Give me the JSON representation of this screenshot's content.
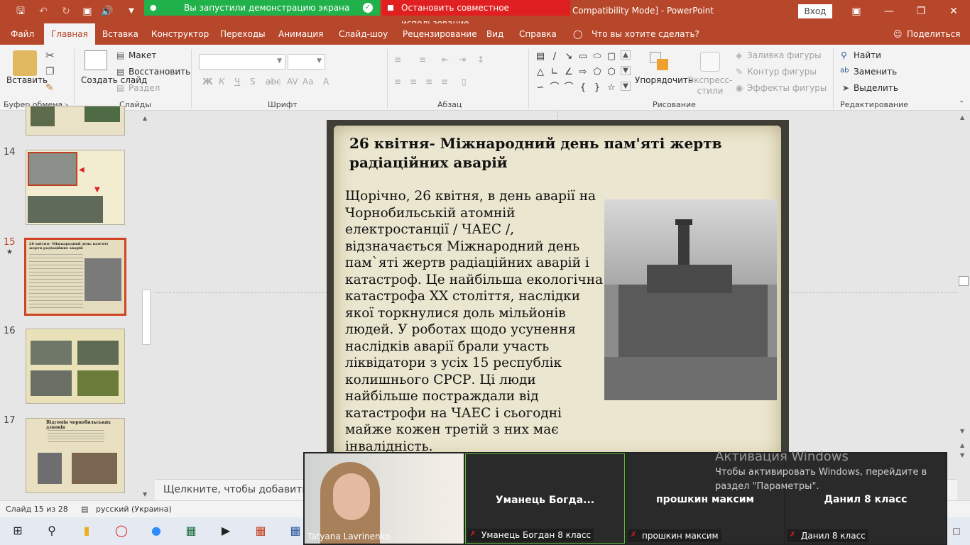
{
  "window": {
    "doc_title": "Compatibility Mode]  -  PowerPoint",
    "signin": "Вход"
  },
  "share_bar": {
    "status": "Вы запустили демонстрацию экрана",
    "stop": "Остановить совместное использование"
  },
  "tabs": [
    "Файл",
    "Главная",
    "Вставка",
    "Конструктор",
    "Переходы",
    "Анимация",
    "Слайд-шоу",
    "Рецензирование",
    "Вид",
    "Справка"
  ],
  "tell_me": "Что вы хотите сделать?",
  "share_label": "Поделиться",
  "ribbon": {
    "paste": "Вставить",
    "clipboard_group": "Буфер обмена",
    "new_slide": "Создать слайд",
    "layout": "Макет",
    "reset": "Восстановить",
    "section": "Раздел",
    "slides_group": "Слайды",
    "font_group": "Шрифт",
    "paragraph_group": "Абзац",
    "arrange": "Упорядочить",
    "quick_styles": "Экспресс-стили",
    "shape_fill": "Заливка фигуры",
    "shape_outline": "Контур фигуры",
    "shape_effects": "Эффекты фигуры",
    "drawing_group": "Рисование",
    "find": "Найти",
    "replace": "Заменить",
    "select": "Выделить",
    "editing_group": "Редактирование"
  },
  "thumbs": [
    {
      "num": "14"
    },
    {
      "num": "15",
      "text": "26 квітня- Міжнародний день пам'яті жертв радіаційних аварій"
    },
    {
      "num": "16"
    },
    {
      "num": "17",
      "text": "Відгомін чорнобильських дзвонів"
    }
  ],
  "slide": {
    "title": "26 квітня- Міжнародний день пам'яті жертв радіаційних аварій",
    "body": "Щорічно, 26 квітня, в день аварії на Чорнобильській атомній електростанції / ЧАЕС /, відзначається Міжнародний день пам`яті жертв радіаційних аварій і катастроф. Це найбільша екологічна катастрофа ХХ століття, наслідки якої торкнулися доль мільйонів людей. У роботах щодо усунення наслідків аварії брали участь ліквідатори з усіх 15 республік колишнього СРСР. Ці люди найбільше постраждали від катастрофи на ЧАЕС і сьогодні майже кожен третій з них має інвалідність."
  },
  "notes_placeholder": "Щелкните, чтобы добавить за",
  "status": {
    "slide_pos": "Слайд 15 из 28",
    "language": "русский (Украина)"
  },
  "zoom": {
    "participants": [
      {
        "label": "Tatyana Lavrinenko"
      },
      {
        "name": "Уманець  Богда...",
        "label": "Уманець Богдан 8 класс"
      },
      {
        "name": "прошкин максим",
        "label": "прошкин максим"
      },
      {
        "name": "Данил 8 класс",
        "label": "Данил 8 класс"
      }
    ]
  },
  "activation": {
    "title": "Активация Windows",
    "text": "Чтобы активировать Windows, перейдите в раздел \"Параметры\"."
  }
}
